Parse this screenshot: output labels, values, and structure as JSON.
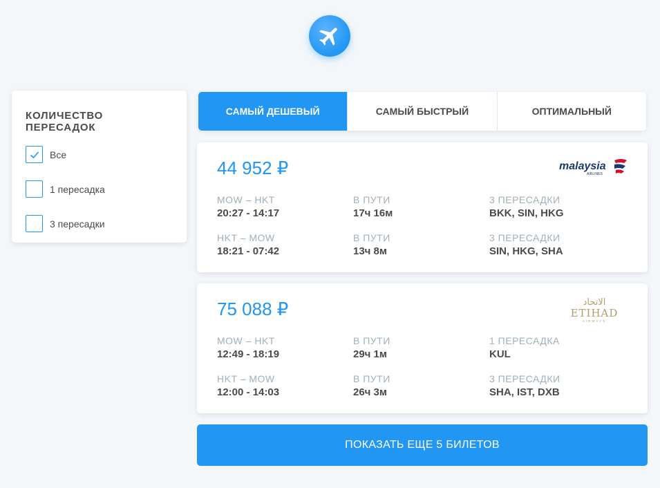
{
  "logo": {
    "icon": "airplane-icon"
  },
  "filter": {
    "title": "КОЛИЧЕСТВО ПЕРЕСАДОК",
    "options": [
      {
        "label": "Все",
        "checked": true
      },
      {
        "label": "1 пересадка",
        "checked": false
      },
      {
        "label": "3 пересадки",
        "checked": false
      }
    ]
  },
  "tabs": [
    {
      "label": "САМЫЙ ДЕШЕВЫЙ",
      "active": true
    },
    {
      "label": "САМЫЙ БЫСТРЫЙ",
      "active": false
    },
    {
      "label": "ОПТИМАЛЬНЫЙ",
      "active": false
    }
  ],
  "tickets": [
    {
      "price": "44 952 ₽",
      "carrier": "malaysia",
      "carrier_sub": "AIRLINES",
      "segments": [
        {
          "route": "MOW – HKT",
          "time": "20:27 - 14:17",
          "dur_label": "В ПУТИ",
          "duration": "17ч 16м",
          "stops_label": "3 ПЕРЕСАДКИ",
          "stops": "BKK, SIN, HKG"
        },
        {
          "route": "HKT – MOW",
          "time": "18:21 - 07:42",
          "dur_label": "В ПУТИ",
          "duration": "13ч 8м",
          "stops_label": "3 ПЕРЕСАДКИ",
          "stops": "SIN, HKG, SHA"
        }
      ]
    },
    {
      "price": "75 088 ₽",
      "carrier": "ETIHAD",
      "carrier_arabic": "الاتحاد",
      "carrier_sub": "AIRWAYS",
      "segments": [
        {
          "route": "MOW – HKT",
          "time": "12:49 - 18:19",
          "dur_label": "В ПУТИ",
          "duration": "29ч 1м",
          "stops_label": "1 ПЕРЕСАДКА",
          "stops": "KUL"
        },
        {
          "route": "HKT – MOW",
          "time": "12:00 - 14:03",
          "dur_label": "В ПУТИ",
          "duration": "26ч 3м",
          "stops_label": "3 ПЕРЕСАДКИ",
          "stops": "SHA, IST, DXB"
        }
      ]
    }
  ],
  "more_button": "ПОКАЗАТЬ ЕЩЕ 5 БИЛЕТОВ",
  "colors": {
    "accent": "#2196f3",
    "label": "#a0b0b9",
    "text": "#4a4a4a"
  }
}
